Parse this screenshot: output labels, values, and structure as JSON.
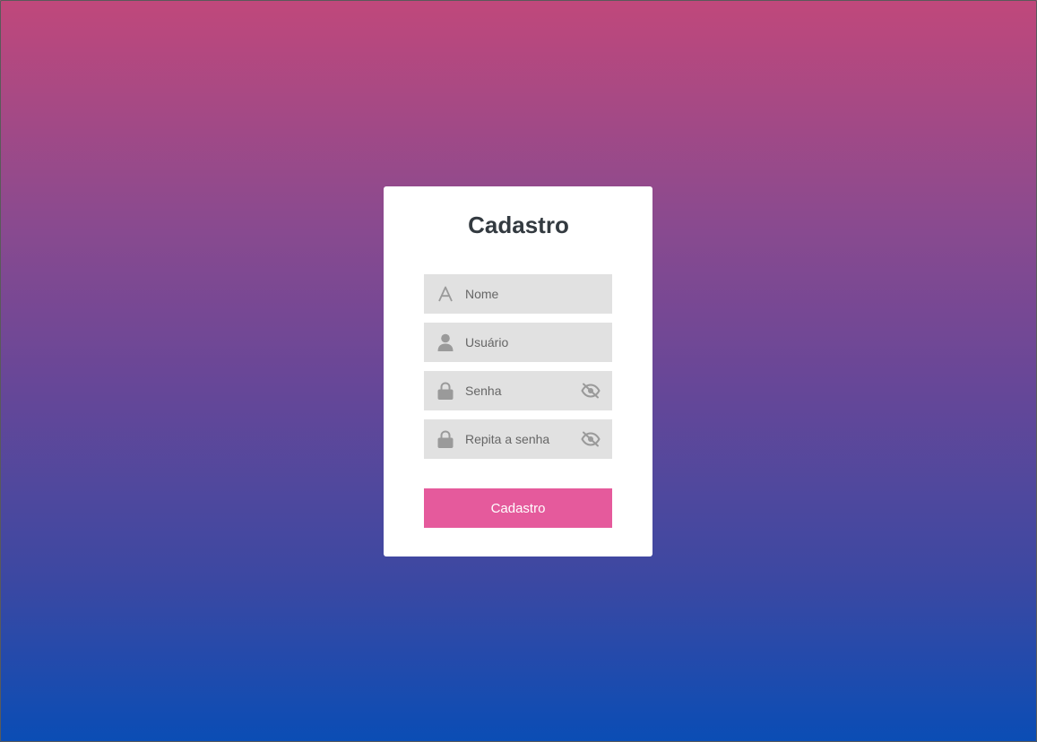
{
  "form": {
    "title": "Cadastro",
    "fields": [
      {
        "placeholder": "Nome",
        "icon": "letter-a-icon",
        "value": ""
      },
      {
        "placeholder": "Usuário",
        "icon": "user-icon",
        "value": ""
      },
      {
        "placeholder": "Senha",
        "icon": "lock-icon",
        "value": "",
        "toggle_icon": "eye-slash-icon"
      },
      {
        "placeholder": "Repita a senha",
        "icon": "lock-icon",
        "value": "",
        "toggle_icon": "eye-slash-icon"
      }
    ],
    "submit_label": "Cadastro"
  },
  "colors": {
    "background_top": "#c0487b",
    "background_bottom": "#0a4db5",
    "card": "#ffffff",
    "field_bg": "#e1e1e1",
    "icon": "#9a9a9a",
    "button": "#e55a9c",
    "title": "#333a40"
  }
}
